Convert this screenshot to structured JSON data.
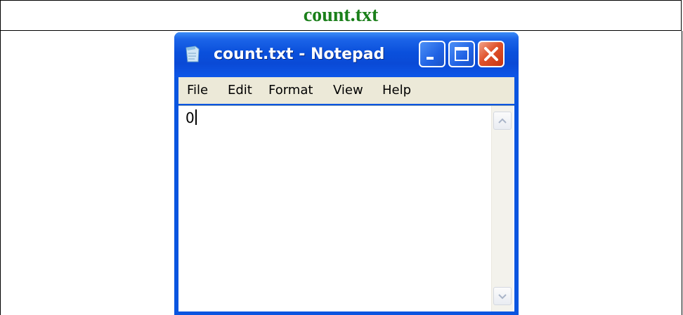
{
  "header": {
    "title": "count.txt"
  },
  "window": {
    "title": "count.txt - Notepad",
    "icon": "notepad-icon",
    "controls": {
      "minimize": "minimize-icon",
      "maximize": "maximize-icon",
      "close": "close-icon"
    }
  },
  "menu": {
    "file": "File",
    "edit": "Edit",
    "format": "Format",
    "view": "View",
    "help": "Help"
  },
  "editor": {
    "content": "0"
  },
  "scrollbar": {
    "up_icon": "chevron-up-icon",
    "down_icon": "chevron-down-icon"
  },
  "colors": {
    "header_text": "#1a7f1a",
    "titlebar": "#0a4ad6",
    "close_button": "#e0532c",
    "menubar": "#ece9d8"
  }
}
